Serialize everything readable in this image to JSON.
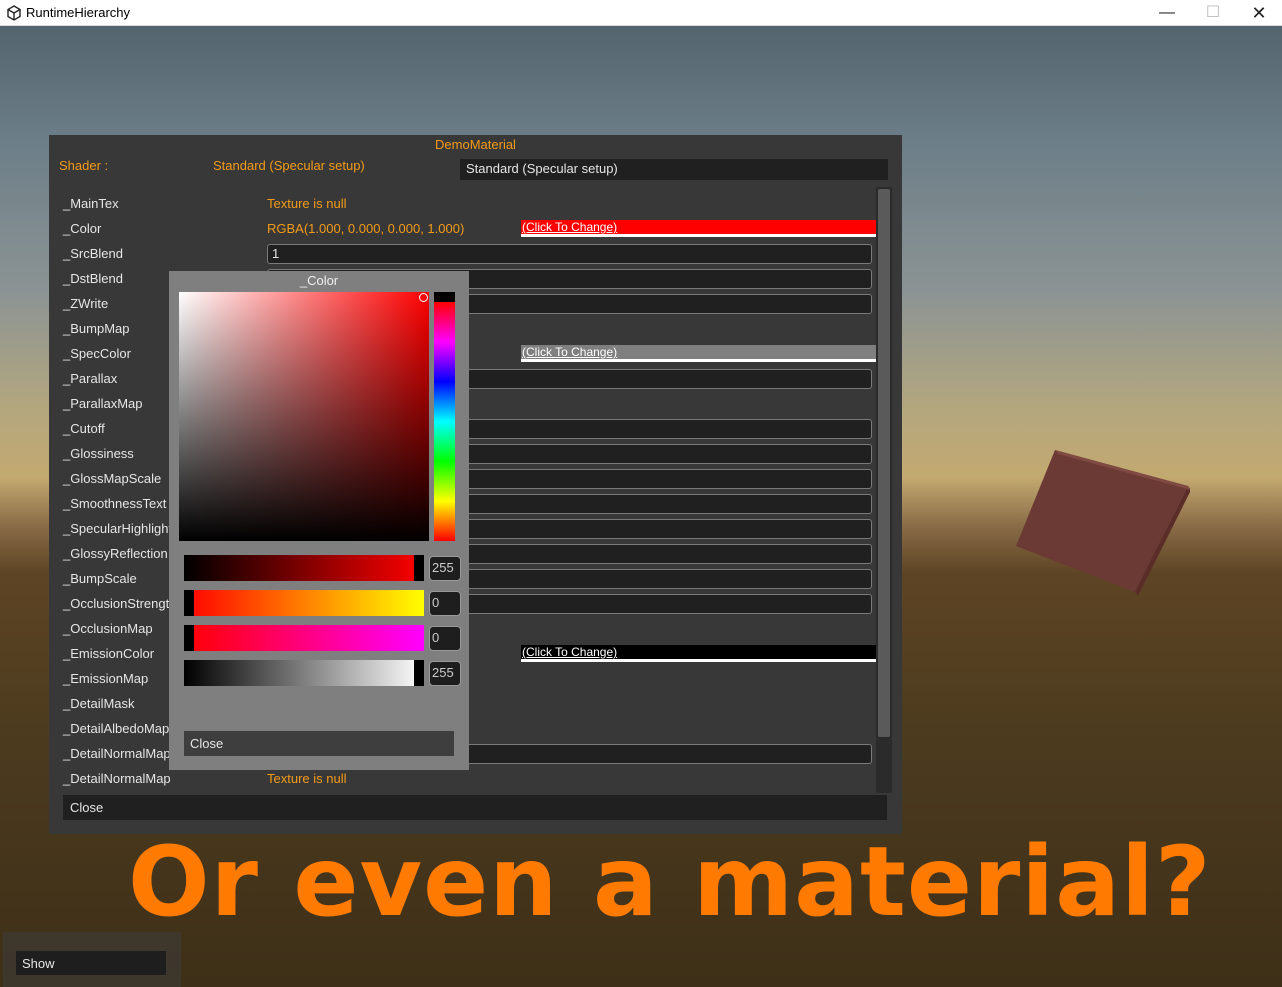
{
  "window": {
    "title": "RuntimeHierarchy",
    "min_glyph": "—",
    "max_glyph": "☐",
    "close_glyph": "✕"
  },
  "overlay_text": "Or even a material?",
  "panel": {
    "title": "DemoMaterial",
    "shader_label": "Shader :",
    "shader_value": "Standard (Specular setup)",
    "shader_select": "Standard (Specular setup)",
    "close_label": "Close",
    "properties": [
      {
        "name": "_MainTex",
        "text": "Texture is null"
      },
      {
        "name": "_Color",
        "text": "RGBA(1.000, 0.000, 0.000, 1.000)",
        "swatch": "(Click To Change)",
        "swatch_color": "#ff0000"
      },
      {
        "name": "_SrcBlend",
        "field": "1"
      },
      {
        "name": "_DstBlend",
        "field": ""
      },
      {
        "name": "_ZWrite",
        "field": ""
      },
      {
        "name": "_BumpMap"
      },
      {
        "name": "_SpecColor",
        "swatch": "(Click To Change)",
        "swatch_color": "#7f7f7f"
      },
      {
        "name": "_Parallax",
        "field": ""
      },
      {
        "name": "_ParallaxMap"
      },
      {
        "name": "_Cutoff",
        "field": ""
      },
      {
        "name": "_Glossiness",
        "field": ""
      },
      {
        "name": "_GlossMapScale",
        "field": ""
      },
      {
        "name": "_SmoothnessText",
        "field": ""
      },
      {
        "name": "_SpecularHighlight",
        "field": ""
      },
      {
        "name": "_GlossyReflection",
        "field": ""
      },
      {
        "name": "_BumpScale",
        "field": ""
      },
      {
        "name": "_OcclusionStrengt",
        "field": ""
      },
      {
        "name": "_OcclusionMap"
      },
      {
        "name": "_EmissionColor",
        "swatch": "(Click To Change)",
        "swatch_color": "#000000"
      },
      {
        "name": "_EmissionMap"
      },
      {
        "name": "_DetailMask"
      },
      {
        "name": "_DetailAlbedoMap"
      },
      {
        "name": "_DetailNormalMap",
        "field": ""
      },
      {
        "name": "_DetailNormalMap",
        "text": "Texture is null"
      }
    ]
  },
  "picker": {
    "title": "_Color",
    "red_value": "255",
    "green_value": "0",
    "blue_value": "0",
    "alpha_value": "255",
    "close_label": "Close"
  },
  "show_button": "Show",
  "colors": {
    "accent_orange": "#f49b17",
    "overlay_orange": "#ff7a00",
    "panel_bg": "#383838",
    "picked_color": "#ff0000"
  }
}
